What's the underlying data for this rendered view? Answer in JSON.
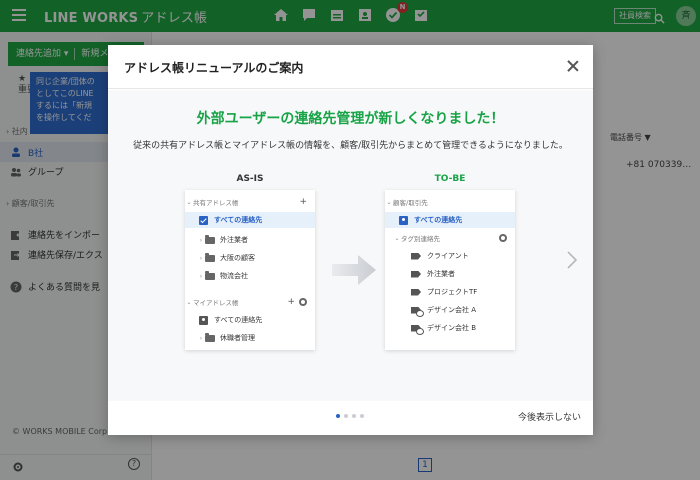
{
  "topbar": {
    "brand": "LINE WORKS",
    "brand_sub": "アドレス帳",
    "notification_badge": "N",
    "employee_search": "社員検索",
    "avatar_initial": "斉",
    "icons": [
      "home-icon",
      "chat-icon",
      "calendar-icon",
      "address-book-icon",
      "task-icon",
      "board-icon"
    ]
  },
  "sidebar": {
    "add_contact": "連絡先追加",
    "new_label": "新規メ",
    "tooltip_lines": [
      "同じ企業/団体の",
      "としてこのLINE",
      "するには「新規",
      "を操作してくだ"
    ],
    "favorites": "重要",
    "section_internal": "社内",
    "item_b": "B社",
    "item_group": "グループ",
    "section_customer": "顧客/取引先",
    "item_import": "連絡先をインポー",
    "item_export": "連絡先保存/エクス",
    "item_faq": "よくある質問を見",
    "copyright": "© WORKS MOBILE Corp."
  },
  "main": {
    "phone_header": "電話番号",
    "phone_value": "+81 070339…",
    "page_number": "1"
  },
  "modal": {
    "title": "アドレス帳リニューアルのご案内",
    "headline": "外部ユーザーの連絡先管理が新しくなりました！",
    "subtext": "従来の共有アドレス帳とマイアドレス帳の情報を、顧客/取引先からまとめて管理できるようになりました。",
    "asis_label": "AS-IS",
    "tobe_label": "TO-BE",
    "asis": {
      "shared_section": "共有アドレス帳",
      "all_contacts": "すべての連絡先",
      "folders": [
        "外注業者",
        "大阪の顧客",
        "物流会社"
      ],
      "my_section": "マイアドレス帳",
      "my_all_contacts": "すべての連絡先",
      "my_folders": [
        "休職者管理"
      ]
    },
    "tobe": {
      "customer_section": "顧客/取引先",
      "all_contacts": "すべての連絡先",
      "tag_section": "タグ別連絡先",
      "tags": [
        "クライアント",
        "外注業者",
        "プロジェクトTF"
      ],
      "shared_tags": [
        "デザイン会社 A",
        "デザイン会社 B"
      ]
    },
    "dont_show": "今後表示しない",
    "page_dots": 4,
    "active_dot": 1
  },
  "colors": {
    "brand_green": "#1faa46",
    "headline_green": "#17a346",
    "selection_blue": "#2a62c4"
  }
}
